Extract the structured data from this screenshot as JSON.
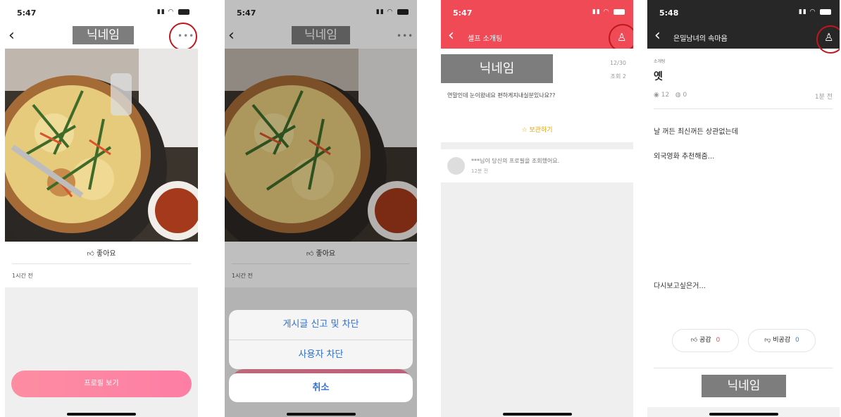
{
  "screens": [
    {
      "time": "5:47",
      "nickname": "닉네임",
      "like_label": "좋아요",
      "posted_ago": "1시간 전",
      "profile_button": "프로필 보기"
    },
    {
      "time": "5:47",
      "nickname": "닉네임",
      "like_label": "좋아요",
      "posted_ago": "1시간 전",
      "sheet_items": [
        "게시글 신고 및 차단",
        "사용자 차단"
      ],
      "cancel_label": "취소"
    },
    {
      "time": "5:47",
      "title": "셀프 소개팅",
      "nickname": "닉네임",
      "date": "12/30",
      "views": "조회 2",
      "message": "연말인데 눈이왔네요 편하게지내실분있나요??",
      "save_label": "보관하기",
      "notice_text": "***님이 당신의 프로필을 조회했어요.",
      "notice_time": "12분 전"
    },
    {
      "time": "5:48",
      "title": "은밀남녀의 속마음",
      "category": "소개팅",
      "post_title": "옛",
      "view_count": "12",
      "comment_count": "0",
      "posted_ago": "1분 전",
      "body_line1": "날 꺼든 최신꺼든 상관없는데",
      "body_line2": "외국영화 추천해줌...",
      "body_line3": "다시보고싶은거...",
      "agree_label": "공감",
      "agree_count": "0",
      "disagree_label": "비공감",
      "disagree_count": "0",
      "nickname": "닉네임"
    }
  ],
  "colors": {
    "red_header": "#ef4a56",
    "dark_header": "#272727",
    "pink_button_start": "#fd8da2",
    "pink_button_end": "#fd7ea4",
    "sheet_text": "#2f6fd0",
    "highlight_ring": "#c0171c",
    "save_star": "#f3b400"
  },
  "icons": {
    "back": "chevron-left-icon",
    "more": "more-dots-icon",
    "alarm": "bell-icon",
    "like": "thumbs-up-icon",
    "star": "star-icon"
  }
}
